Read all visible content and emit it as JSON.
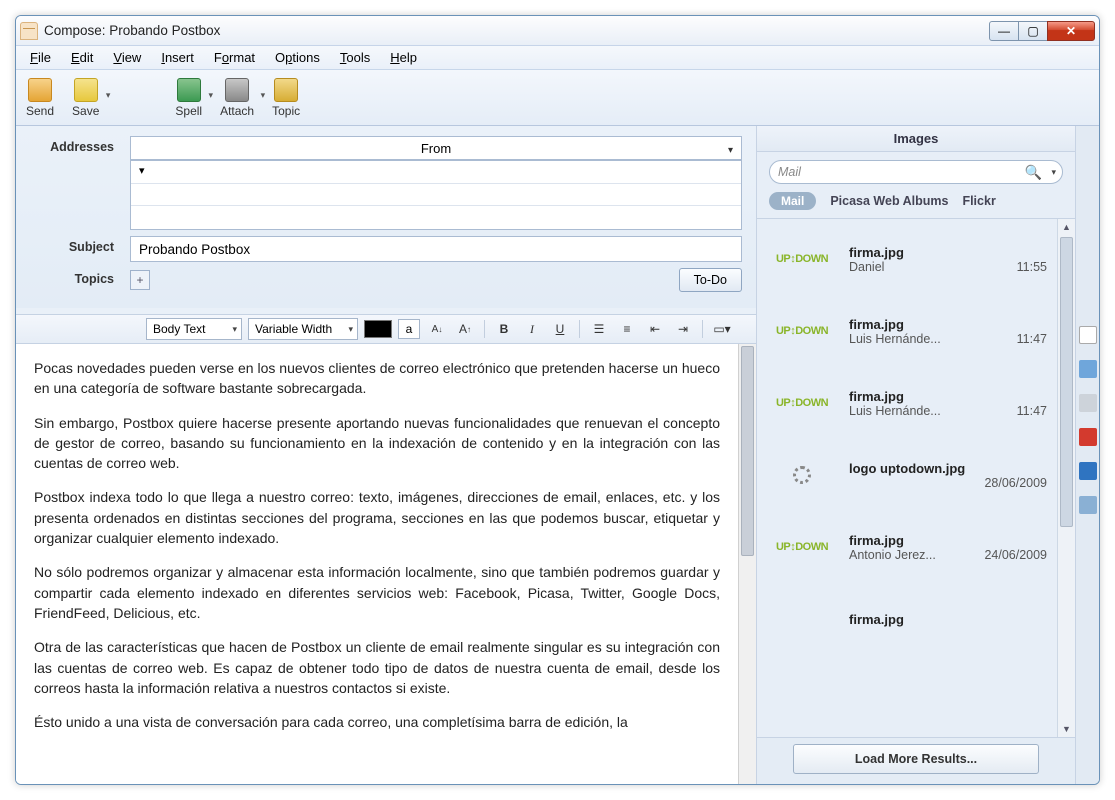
{
  "window": {
    "title": "Compose: Probando Postbox"
  },
  "menubar": [
    "File",
    "Edit",
    "View",
    "Insert",
    "Format",
    "Options",
    "Tools",
    "Help"
  ],
  "toolbar": {
    "send": "Send",
    "save": "Save",
    "spell": "Spell",
    "attach": "Attach",
    "topic": "Topic"
  },
  "header": {
    "addresses_label": "Addresses",
    "from_label": "From",
    "subject_label": "Subject",
    "subject_value": "Probando Postbox",
    "topics_label": "Topics",
    "todo_label": "To-Do"
  },
  "format_bar": {
    "style": "Body Text",
    "font": "Variable Width",
    "sample": "a",
    "dec": "A↓",
    "inc": "A↑",
    "bold": "B",
    "italic": "I",
    "underline": "U"
  },
  "body_paragraphs": [
    "Pocas novedades pueden verse en los nuevos clientes de correo electrónico que pretenden hacerse un hueco en una categoría de software bastante sobrecargada.",
    "Sin embargo, Postbox quiere hacerse presente aportando nuevas funcionalidades que renuevan el concepto de gestor de correo, basando su funcionamiento en la indexación de contenido y en la integración con las cuentas de correo web.",
    "Postbox indexa todo lo que llega a nuestro correo: texto, imágenes, direcciones de email, enlaces, etc. y los presenta ordenados en distintas secciones del programa, secciones en las que podemos buscar, etiquetar y organizar cualquier elemento indexado.",
    "No sólo podremos organizar y almacenar esta información localmente, sino que también podremos guardar y compartir cada elemento indexado en diferentes servicios web: Facebook, Picasa, Twitter, Google Docs, FriendFeed, Delicious, etc.",
    "Otra de las características que hacen de Postbox un cliente de email realmente singular es su integración con las cuentas de correo web. Es capaz de obtener todo tipo de datos de nuestra cuenta de email, desde los correos hasta la información relativa a nuestros contactos si existe.",
    "Ésto unido a una vista de conversación para cada correo, una completísima barra de edición, la"
  ],
  "images_panel": {
    "title": "Images",
    "search_placeholder": "Mail",
    "tabs": {
      "mail": "Mail",
      "picasa": "Picasa Web Albums",
      "flickr": "Flickr"
    },
    "items": [
      {
        "name": "firma.jpg",
        "from": "Daniel",
        "time": "11:55",
        "logo": "uptodown"
      },
      {
        "name": "firma.jpg",
        "from": "Luis Hernánde...",
        "time": "11:47",
        "logo": "uptodown"
      },
      {
        "name": "firma.jpg",
        "from": "Luis Hernánde...",
        "time": "11:47",
        "logo": "uptodown"
      },
      {
        "name": "logo uptodown.jpg",
        "from": "",
        "time": "28/06/2009",
        "logo": "spinner"
      },
      {
        "name": "firma.jpg",
        "from": "Antonio Jerez...",
        "time": "24/06/2009",
        "logo": "uptodown"
      },
      {
        "name": "firma.jpg",
        "from": "",
        "time": "",
        "logo": ""
      }
    ],
    "load_more": "Load More Results..."
  }
}
